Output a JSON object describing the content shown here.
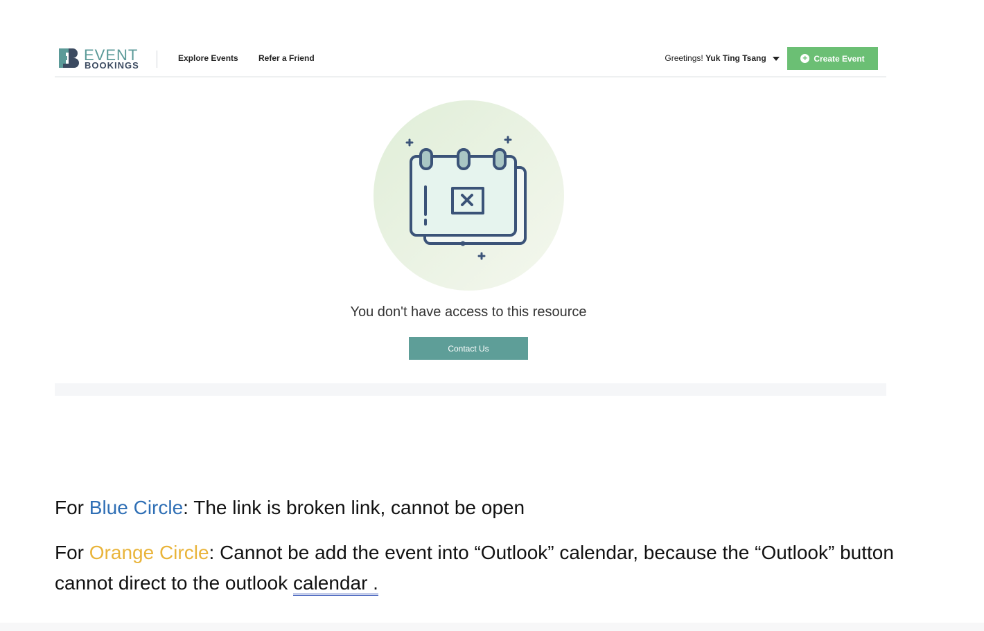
{
  "header": {
    "logo_event": "EVENT",
    "logo_bookings": "BOOKINGS",
    "nav": [
      "Explore Events",
      "Refer a Friend"
    ],
    "greeting_prefix": "Greetings!",
    "user_name": "Yuk Ting Tsang",
    "create_button": "Create Event"
  },
  "main": {
    "message": "You don't have access to this resource",
    "contact_button": "Contact Us"
  },
  "notes": {
    "line1_prefix": "For ",
    "line1_highlight": "Blue Circle",
    "line1_rest": ": The link is broken link, cannot be open",
    "line2_prefix": "For ",
    "line2_highlight": "Orange Circle",
    "line2_rest": ": Cannot be add the event into “Outlook” calendar, because the “Outlook” button cannot direct to the outlook ",
    "line2_link": "calendar ."
  },
  "colors": {
    "accent_green": "#6bbf74",
    "teal": "#5e9e98",
    "blue_label": "#2f6fb5",
    "orange_label": "#e9b43a",
    "icon_navy": "#3b5378"
  },
  "icons": [
    "logo-eb-icon",
    "chevron-down-icon",
    "plus-circle-icon",
    "calendar-x-icon"
  ]
}
